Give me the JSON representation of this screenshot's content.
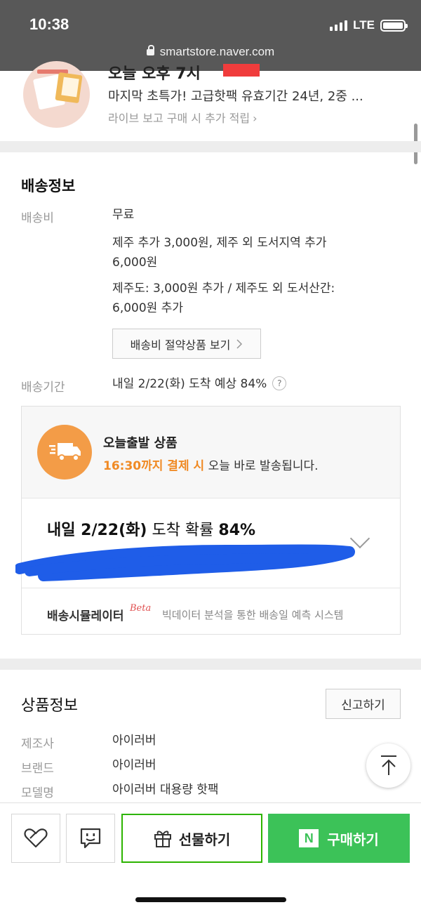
{
  "status_bar": {
    "time": "10:38",
    "network": "LTE",
    "url": "smartstore.naver.com"
  },
  "live": {
    "title_partial": "오늘 오후 7시",
    "description": "마지막 초특가! 고급핫팩 유효기간 24년, 2중 ...",
    "subtext": "라이브 보고 구매 시 추가 적립",
    "chevron": "›"
  },
  "delivery": {
    "title": "배송정보",
    "fee_label": "배송비",
    "fee_value": "무료",
    "fee_note1_line1": "제주 추가 3,000원, 제주 외 도서지역 추가",
    "fee_note1_line2": "6,000원",
    "fee_note2_line1": "제주도: 3,000원 추가 / 제주도 외 도서산간:",
    "fee_note2_line2": "6,000원 추가",
    "saving_button": "배송비 절약상품 보기",
    "period_label": "배송기간",
    "period_value": "내일 2/22(화) 도착 예상 84%",
    "help": "?",
    "card": {
      "title": "오늘출발 상품",
      "cutoff_highlight": "16:30까지 결제 시",
      "cutoff_rest": "오늘 바로 발송됩니다.",
      "arrival_prefix": "내일 2/22(화)",
      "arrival_middle": "도착 확률",
      "arrival_percent": "84%",
      "simulator_name": "배송시뮬레이터",
      "simulator_beta": "Beta",
      "simulator_desc": "빅데이터 분석을 통한 배송일 예측 시스템"
    }
  },
  "product_info": {
    "title": "상품정보",
    "report_button": "신고하기",
    "rows": [
      {
        "label": "제조사",
        "value": "아이러버"
      },
      {
        "label": "브랜드",
        "value": "아이러버"
      },
      {
        "label": "모델명",
        "value": "아이러버 대용량 핫팩"
      }
    ]
  },
  "bottom_bar": {
    "gift_label": "선물하기",
    "buy_label": "구매하기",
    "naver_logo": "N"
  },
  "colors": {
    "accent_green": "#3cc258",
    "gift_border": "#2db400",
    "truck_orange": "#f39c47",
    "highlight_orange": "#f08a24",
    "redaction_blue": "#1f5de8"
  },
  "icons": [
    "lock-icon",
    "heart-icon",
    "chat-icon",
    "gift-icon",
    "naver-n-icon",
    "truck-icon",
    "arrow-up-icon",
    "chevron-down-icon",
    "help-icon"
  ]
}
